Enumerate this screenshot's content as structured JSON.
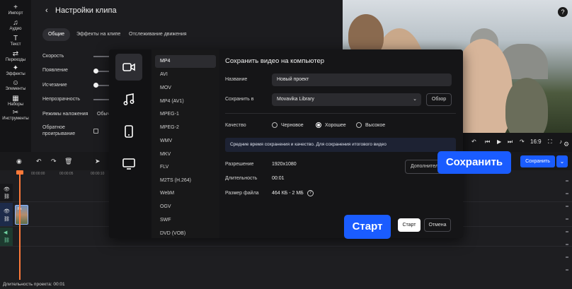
{
  "left_tools": [
    {
      "label": "Импорт",
      "icon": "plus-icon",
      "glyph": "+"
    },
    {
      "label": "Аудио",
      "icon": "music-note-icon",
      "glyph": "♫"
    },
    {
      "label": "Текст",
      "icon": "text-icon",
      "glyph": "T"
    },
    {
      "label": "Переходы",
      "icon": "transitions-icon",
      "glyph": "⇄"
    },
    {
      "label": "Эффекты",
      "icon": "effects-icon",
      "glyph": "✦"
    },
    {
      "label": "Элементы",
      "icon": "elements-icon",
      "glyph": "☺"
    },
    {
      "label": "Наборы",
      "icon": "sets-icon",
      "glyph": "▦"
    },
    {
      "label": "Инструменты",
      "icon": "tools-icon",
      "glyph": "✂"
    }
  ],
  "settings": {
    "back_glyph": "‹",
    "title": "Настройки клипа",
    "tabs": [
      "Общие",
      "Эффекты на клипе",
      "Отслеживание движения"
    ],
    "rows": [
      "Скорость",
      "Появление",
      "Исчезание",
      "Непрозрачность",
      "Режимы наложения",
      "Обратное",
      "проигрывание"
    ],
    "blend_value": "Обыч"
  },
  "preview": {
    "help_glyph": "?"
  },
  "player": {
    "aspect": "16:9"
  },
  "timeline": {
    "ruler": [
      "00:00:00",
      "00:00:05",
      "00:00:10"
    ],
    "clip_label": "Fx",
    "duration_label": "Длительность проекта: 00:01"
  },
  "modal": {
    "categories": [
      "video-icon",
      "music-icon",
      "phone-icon",
      "tv-icon"
    ],
    "formats": [
      "MP4",
      "AVI",
      "MOV",
      "MP4 (AV1)",
      "MPEG-1",
      "MPEG-2",
      "WMV",
      "MKV",
      "FLV",
      "M2TS (H.264)",
      "WebM",
      "OGV",
      "SWF",
      "DVD (VOB)"
    ],
    "title": "Сохранить видео на компьютер",
    "name_label": "Название",
    "name_value": "Новый проект",
    "save_to_label": "Сохранить в",
    "save_to_value": "Movavika Library",
    "browse": "Обзор",
    "quality_label": "Качество",
    "quality_options": [
      "Черновое",
      "Хорошее",
      "Высокое"
    ],
    "quality_selected": "Хорошее",
    "info": "Средние время сохранения и качество. Для сохранения итогового видео",
    "resolution_label": "Разрешение",
    "resolution_value": "1920x1080",
    "duration_label": "Длительность",
    "duration_value": "00:01",
    "size_label": "Размер файла",
    "size_value": "464 КБ - 2 МБ",
    "size_help": "?",
    "extra": "Дополнительно",
    "start": "Старт",
    "cancel": "Отмена"
  },
  "callouts": {
    "save": "Сохранить",
    "start": "Старт"
  },
  "save_button": {
    "label": "Сохранить",
    "dropdown_glyph": "⌄"
  },
  "colors": {
    "accent": "#1a5cff",
    "playhead": "#ff7a3a"
  }
}
